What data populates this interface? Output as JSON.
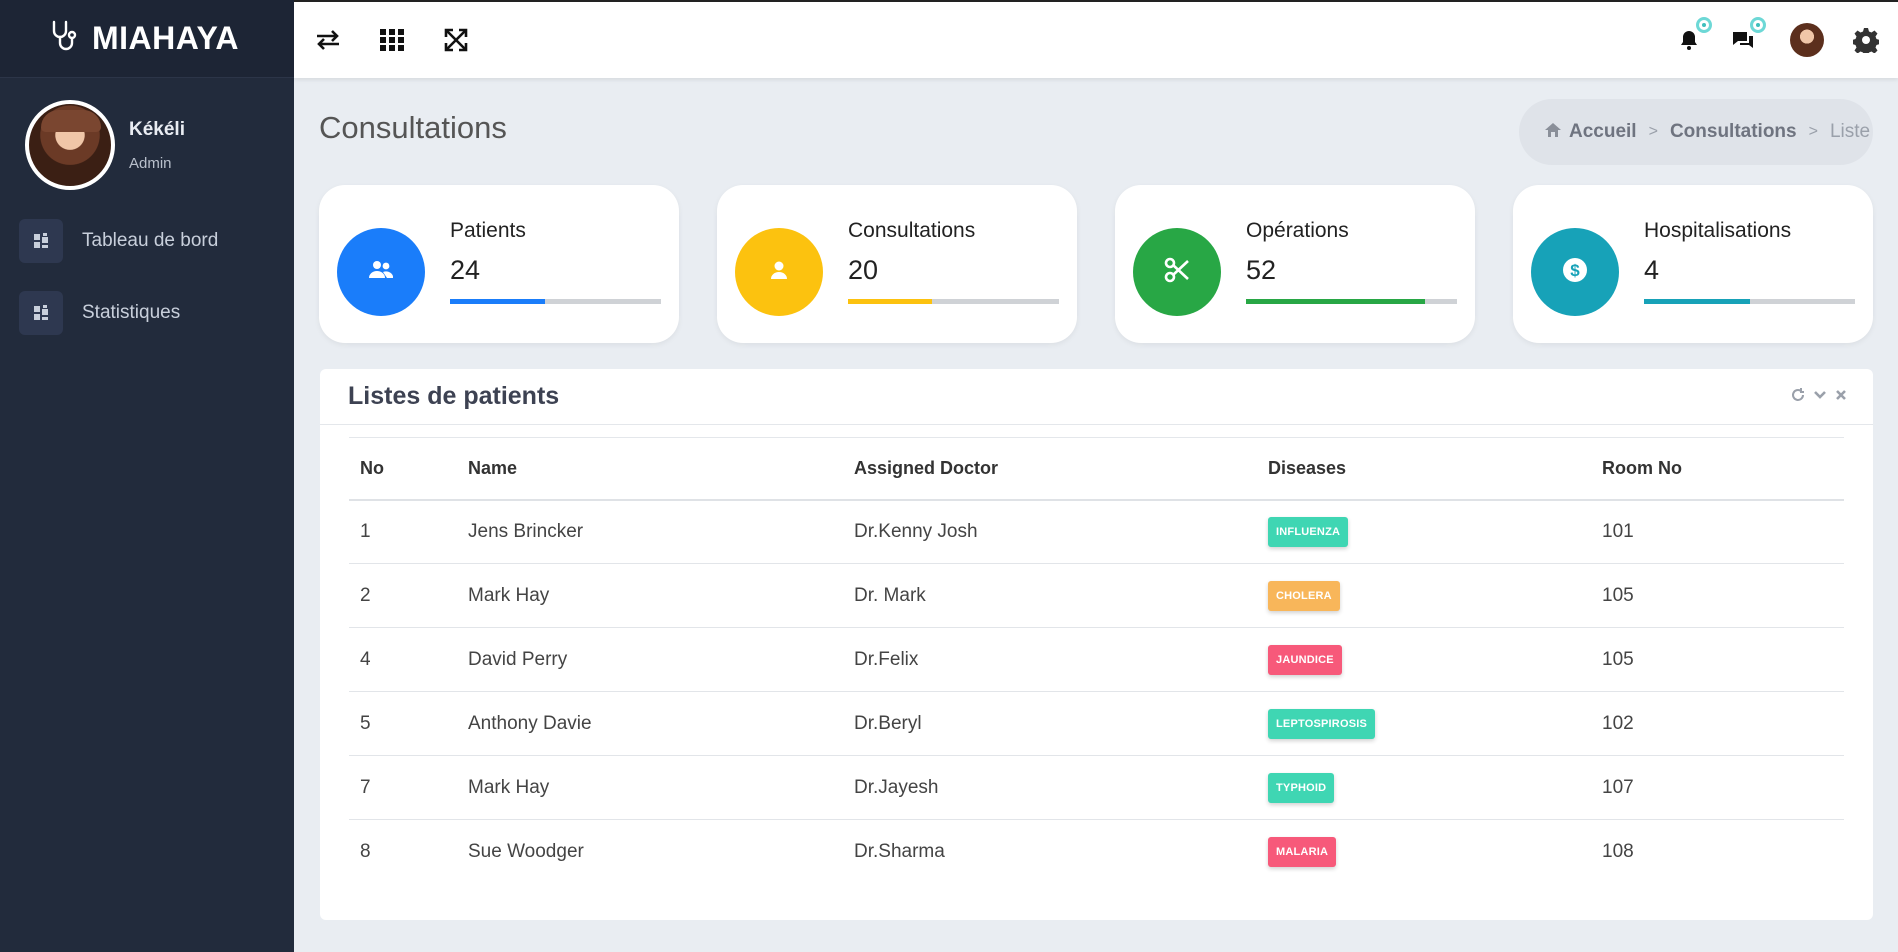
{
  "app": {
    "name": "MIAHAYA"
  },
  "user": {
    "name": "Kékéli",
    "role": "Admin"
  },
  "sidebar": {
    "items": [
      {
        "label": "Tableau de bord",
        "icon": "dashboard-icon"
      },
      {
        "label": "Statistiques",
        "icon": "dashboard-icon"
      }
    ]
  },
  "topbar": {
    "icons": [
      "exchange-icon",
      "apps-grid-icon",
      "fullscreen-icon"
    ],
    "right_icons": [
      "bell-icon",
      "chat-icon",
      "avatar",
      "gear-icon"
    ]
  },
  "page": {
    "title": "Consultations"
  },
  "breadcrumb": {
    "home": "Accueil",
    "section": "Consultations",
    "current": "Liste"
  },
  "stats": [
    {
      "label": "Patients",
      "value": "24",
      "color": "#1a7dfa",
      "progress": 0.45,
      "icon": "users-icon"
    },
    {
      "label": "Consultations",
      "value": "20",
      "color": "#fcc20f",
      "progress": 0.4,
      "icon": "user-icon"
    },
    {
      "label": "Opérations",
      "value": "52",
      "color": "#28a745",
      "progress": 0.85,
      "icon": "scissors-icon"
    },
    {
      "label": "Hospitalisations",
      "value": "4",
      "color": "#17a2b8",
      "progress": 0.5,
      "icon": "dollar-icon"
    }
  ],
  "table": {
    "title": "Listes de patients",
    "columns": [
      "No",
      "Name",
      "Assigned Doctor",
      "Diseases",
      "Room No"
    ],
    "rows": [
      {
        "no": "1",
        "name": "Jens Brincker",
        "doctor": "Dr.Kenny Josh",
        "disease": "INFLUENZA",
        "disease_color": "#3fd6b3",
        "room": "101"
      },
      {
        "no": "2",
        "name": "Mark Hay",
        "doctor": "Dr. Mark",
        "disease": "CHOLERA",
        "disease_color": "#f8b65a",
        "room": "105"
      },
      {
        "no": "4",
        "name": "David Perry",
        "doctor": "Dr.Felix",
        "disease": "JAUNDICE",
        "disease_color": "#f7597a",
        "room": "105"
      },
      {
        "no": "5",
        "name": "Anthony Davie",
        "doctor": "Dr.Beryl",
        "disease": "LEPTOSPIROSIS",
        "disease_color": "#3fd6b3",
        "room": "102"
      },
      {
        "no": "7",
        "name": "Mark Hay",
        "doctor": "Dr.Jayesh",
        "disease": "TYPHOID",
        "disease_color": "#3fd6b3",
        "room": "107"
      },
      {
        "no": "8",
        "name": "Sue Woodger",
        "doctor": "Dr.Sharma",
        "disease": "MALARIA",
        "disease_color": "#f7597a",
        "room": "108"
      }
    ]
  }
}
